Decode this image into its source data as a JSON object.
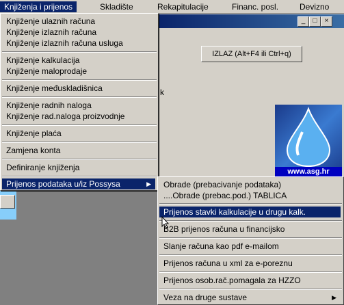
{
  "menubar": {
    "items": [
      "Knjiženja i prijenos",
      "Skladište",
      "Rekapitulacije",
      "Financ. posl.",
      "Devizno"
    ]
  },
  "window": {
    "izlaz_label": "IZLAZ (Alt+F4 ili Ctrl+q)",
    "logo_url": "www.asg.hr",
    "side_letter": "k"
  },
  "main_menu": {
    "items": [
      "Knjiženje ulaznih računa",
      "Knjiženje izlaznih računa",
      "Knjiženje izlaznih računa usluga",
      "Knjiženje kalkulacija",
      "Knjiženje maloprodaje",
      "Knjiženje međuskladišnica",
      "Knjiženje radnih naloga",
      "Knjiženje rad.naloga proizvodnje",
      "Knjiženje plaća",
      "Zamjena konta",
      "Definiranje knjiženja",
      "Prijenos podataka u/iz Possysa"
    ]
  },
  "sub_menu": {
    "items": [
      "Obrade (prebacivanje podataka)",
      "....Obrade (prebac.pod.) TABLICA",
      "Prijenos stavki kalkulacije u drugu kalk.",
      "B2B prijenos računa u financijsko",
      "Slanje računa kao pdf e-mailom",
      "Prijenos računa u xml za e-poreznu",
      "Prijenos osob.rač.pomagala za HZZO",
      "Veza na druge sustave"
    ]
  },
  "colors": {
    "highlight": "#0a246a",
    "menu_bg": "#d4d0c8"
  }
}
